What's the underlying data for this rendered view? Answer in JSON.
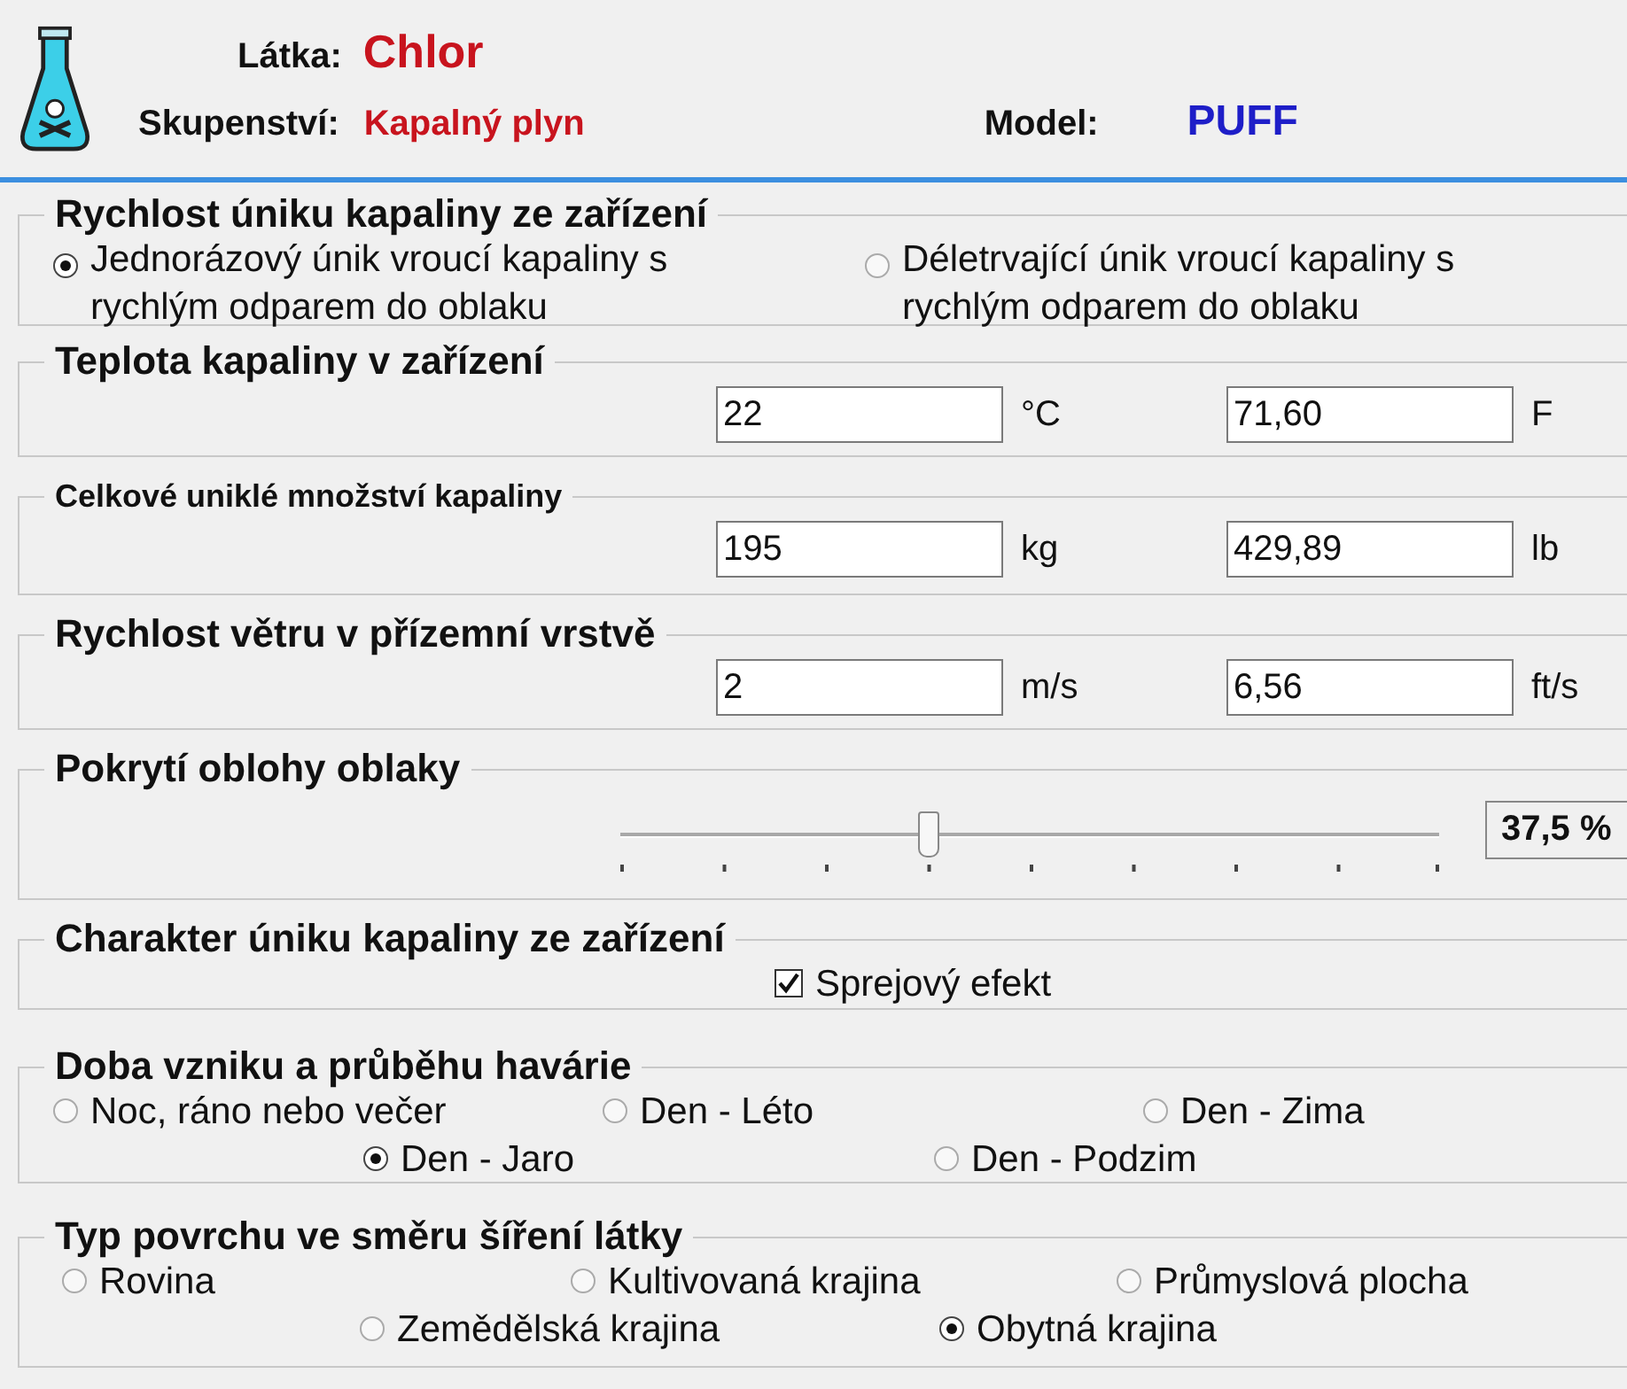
{
  "header": {
    "substance_label": "Látka:",
    "substance": "Chlor",
    "state_label": "Skupenství:",
    "state": "Kapalný plyn",
    "model_label": "Model:",
    "model": "PUFF"
  },
  "groups": [
    {
      "kind": "radio",
      "title": "Rychlost úniku kapaliny ze zařízení",
      "rows": [
        [
          {
            "label": "Jednorázový únik vroucí kapaliny s rychlým odparem do oblaku",
            "selected": true
          },
          {
            "label": "Déletrvající únik vroucí kapaliny s rychlým odparem do oblaku",
            "selected": false
          }
        ]
      ]
    },
    {
      "kind": "measure",
      "title": "Teplota kapaliny v zařízení",
      "fields": [
        {
          "value": "22",
          "unit": "°C"
        },
        {
          "value": "71,60",
          "unit": "F"
        }
      ]
    },
    {
      "kind": "measure",
      "title": "Celkové uniklé množství kapaliny",
      "fields": [
        {
          "value": "195",
          "unit": "kg"
        },
        {
          "value": "429,89",
          "unit": "lb"
        }
      ]
    },
    {
      "kind": "measure",
      "title": "Rychlost větru v přízemní vrstvě",
      "fields": [
        {
          "value": "2",
          "unit": "m/s"
        },
        {
          "value": "6,56",
          "unit": "ft/s"
        }
      ]
    },
    {
      "kind": "slider",
      "title": "Pokrytí oblohy oblaky",
      "level": 0.375,
      "reading": "37,5 %"
    },
    {
      "kind": "checkbox",
      "title": "Charakter úniku kapaliny ze zařízení",
      "label": "Sprejový efekt",
      "checked": true
    },
    {
      "kind": "radio",
      "title": "Doba vzniku a průběhu havárie",
      "rows": [
        [
          {
            "label": "Noc, ráno nebo večer",
            "selected": false
          },
          {
            "label": "Den - Léto",
            "selected": false
          },
          {
            "label": "Den - Zima",
            "selected": false
          }
        ],
        [
          {
            "label": "Den - Jaro",
            "selected": true
          },
          {
            "label": "Den - Podzim",
            "selected": false
          }
        ]
      ]
    },
    {
      "kind": "radio",
      "title": "Typ povrchu ve směru šíření látky",
      "rows": [
        [
          {
            "label": "Rovina",
            "selected": false
          },
          {
            "label": "Kultivovaná krajina",
            "selected": false
          },
          {
            "label": "Průmyslová plocha",
            "selected": false
          }
        ],
        [
          {
            "label": "Zemědělská krajina",
            "selected": false
          },
          {
            "label": "Obytná krajina",
            "selected": true
          }
        ]
      ]
    }
  ]
}
